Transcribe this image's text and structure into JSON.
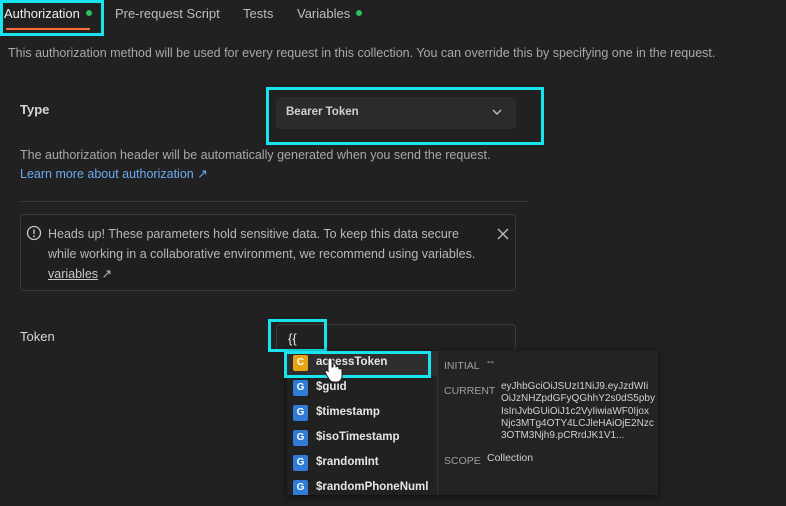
{
  "tabs": [
    {
      "label": "Authorization",
      "dot": true
    },
    {
      "label": "Pre-request Script"
    },
    {
      "label": "Tests"
    },
    {
      "label": "Variables",
      "dot": true
    }
  ],
  "description": "This authorization method will be used for every request in this collection. You can override this by specifying one in the request.",
  "type": {
    "label": "Type",
    "value": "Bearer Token",
    "info": "The authorization header will be automatically generated when you send the request.",
    "learn_more": "Learn more about authorization ↗"
  },
  "alert": {
    "text": "Heads up! These parameters hold sensitive data. To keep this data secure while working in a collaborative environment, we recommend using variables.",
    "link": "variables",
    "link_suffix": "↗"
  },
  "token": {
    "label": "Token",
    "value": "{{"
  },
  "suggestions": [
    {
      "badge": "C",
      "label": "accessToken"
    },
    {
      "badge": "G",
      "label": "$guid"
    },
    {
      "badge": "G",
      "label": "$timestamp"
    },
    {
      "badge": "G",
      "label": "$isoTimestamp"
    },
    {
      "badge": "G",
      "label": "$randomInt"
    },
    {
      "badge": "G",
      "label": "$randomPhoneNuml"
    }
  ],
  "detail": {
    "initial_label": "INITIAL",
    "initial_value": "--",
    "current_label": "CURRENT",
    "current_value": "eyJhbGciOiJSUzI1NiJ9.eyJzdWIiOiJzNHZpdGFyQGhhY2s0dS5pbyIsInJvbGUiOiJ1c2VyIiwiaWF0IjoxNjc3MTg4OTY4LCJleHAiOjE2Nzc3OTM3Njh9.pCRrdJK1V1...",
    "scope_label": "SCOPE",
    "scope_value": "Collection"
  },
  "colors": {
    "highlight": "#18e4f0",
    "accent": "#ff6c37",
    "status_dot": "#2fbf63",
    "link": "#6ca9f2",
    "badge_collection": "#e8a317",
    "badge_global": "#2f7bd6"
  }
}
